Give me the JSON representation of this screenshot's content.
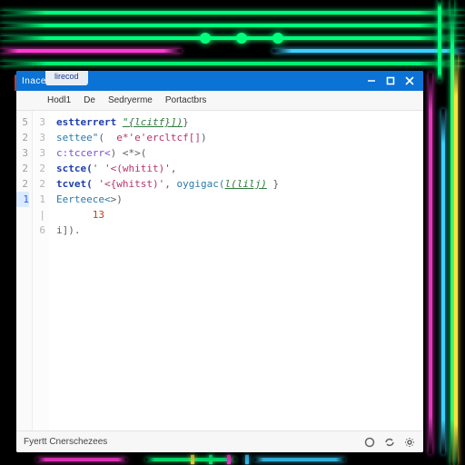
{
  "titlebar": {
    "title": "Inacepcultan"
  },
  "tab": {
    "label": "lirecod"
  },
  "menubar": {
    "items": [
      "Hodl1",
      "De",
      "Sedryerme",
      "Portactbrs"
    ]
  },
  "gutter1": [
    "5",
    "2",
    "3",
    "2",
    "2",
    "1",
    "",
    "",
    "",
    "",
    "",
    "",
    "",
    "",
    "",
    "",
    "",
    "",
    "",
    "",
    ""
  ],
  "gutter2": [
    "3",
    "3",
    "3",
    "2",
    "2",
    "1",
    "|",
    "",
    "",
    "",
    "",
    "",
    "",
    "",
    "",
    "",
    "",
    "",
    "",
    "6",
    ""
  ],
  "code": {
    "lines": [
      {
        "frags": [
          {
            "cls": "kw",
            "t": "estterrert"
          },
          {
            "cls": "op",
            "t": " "
          },
          {
            "cls": "id",
            "t": "\"{lcitf}])"
          },
          {
            "cls": "op",
            "t": "}"
          }
        ]
      },
      {
        "frags": [
          {
            "cls": "fn",
            "t": "settee\""
          },
          {
            "cls": "op",
            "t": "(  "
          },
          {
            "cls": "str",
            "t": "e*'e'ercltcf[]"
          },
          {
            "cls": "op",
            "t": ")"
          }
        ]
      },
      {
        "frags": [
          {
            "cls": "var",
            "t": "c:tccerr<"
          },
          {
            "cls": "op",
            "t": ") <*>("
          }
        ]
      },
      {
        "frags": [
          {
            "cls": "kw",
            "t": "sctce("
          },
          {
            "cls": "op",
            "t": "' "
          },
          {
            "cls": "str",
            "t": "'<(whitit)"
          },
          {
            "cls": "op",
            "t": "',"
          }
        ]
      },
      {
        "frags": [
          {
            "cls": "kw",
            "t": "tcvet("
          },
          {
            "cls": "op",
            "t": " "
          },
          {
            "cls": "str",
            "t": "'<{whitst)'"
          },
          {
            "cls": "op",
            "t": ", "
          },
          {
            "cls": "fn",
            "t": "oygigac("
          },
          {
            "cls": "id",
            "t": "l(lilj)"
          },
          {
            "cls": "op",
            "t": " }"
          }
        ]
      },
      {
        "frags": [
          {
            "cls": "fn",
            "t": "Eerteece<"
          },
          {
            "cls": "op",
            "t": ">)"
          }
        ]
      },
      {
        "frags": [
          {
            "cls": "num",
            "t": "      13"
          }
        ]
      },
      {
        "frags": [
          {
            "cls": "op",
            "t": ""
          }
        ]
      },
      {
        "frags": [
          {
            "cls": "op",
            "t": "i])."
          }
        ]
      }
    ]
  },
  "status": {
    "left": "Fyertt Cnerschezees"
  }
}
